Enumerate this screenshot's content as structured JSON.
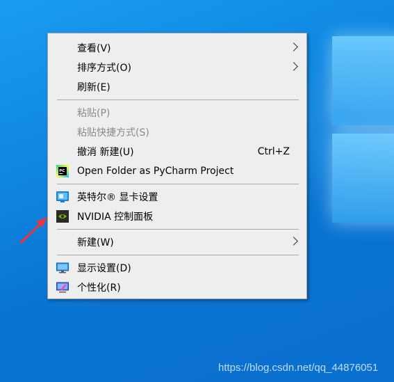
{
  "menu": {
    "items": [
      {
        "label": "查看(V)",
        "has_submenu": true
      },
      {
        "label": "排序方式(O)",
        "has_submenu": true
      },
      {
        "label": "刷新(E)"
      },
      {
        "label": "粘贴(P)",
        "disabled": true
      },
      {
        "label": "粘贴快捷方式(S)",
        "disabled": true
      },
      {
        "label": "撤消 新建(U)",
        "shortcut": "Ctrl+Z"
      },
      {
        "label": "Open Folder as PyCharm Project",
        "icon": "pycharm-icon"
      },
      {
        "label": "英特尔® 显卡设置",
        "icon": "intel-graphics-icon"
      },
      {
        "label": "NVIDIA 控制面板",
        "icon": "nvidia-icon"
      },
      {
        "label": "新建(W)",
        "has_submenu": true
      },
      {
        "label": "显示设置(D)",
        "icon": "display-settings-icon"
      },
      {
        "label": "个性化(R)",
        "icon": "personalize-icon"
      }
    ]
  },
  "watermark": "https://blog.csdn.net/qq_44876051",
  "colors": {
    "desktop_blue": "#0f86e0",
    "menu_bg": "#eeeeee",
    "disabled_text": "#8a8a8a",
    "arrow_red": "#e8363c"
  }
}
